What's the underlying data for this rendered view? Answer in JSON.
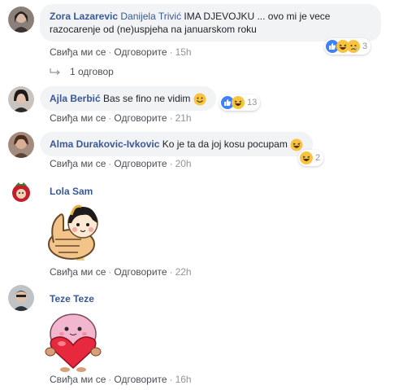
{
  "comments": [
    {
      "author": "Zora Lazarevic",
      "mention": "Danijela Trivić",
      "text": " IMA DJEVOJKU ... ovo mi je vece razocarenje od (ne)uspjeha na januarskom roku",
      "line1": " IMA DJEVOJKU ... ovo mi je vece",
      "line2": "razocarenje od (ne)uspjeha na januarskom roku",
      "like": "Свиђа ми се",
      "reply": "Одговорите",
      "time": "15h",
      "reaction_count": "3",
      "reactions": [
        "like-icon",
        "haha-icon",
        "sad-icon"
      ],
      "replies": "1 одговор"
    },
    {
      "author": "Ajla Berbić",
      "text": "Bas se fino ne vidim",
      "like": "Свиђа ми се",
      "reply": "Одговорите",
      "time": "21h",
      "reaction_count": "13",
      "reactions": [
        "like-icon",
        "haha-icon"
      ]
    },
    {
      "author": "Alma Durakovic-Ivkovic",
      "text": "Ko je ta da joj kosu pocupam",
      "like": "Свиђа ми се",
      "reply": "Одговорите",
      "time": "20h",
      "reaction_count": "2",
      "reactions": [
        "haha-icon"
      ]
    },
    {
      "author": "Lola Sam",
      "like": "Свиђа ми се",
      "reply": "Одговорите",
      "time": "22h",
      "sticker": "thumbs-up-girl-sticker"
    },
    {
      "author": "Teze Teze",
      "like": "Свиђа ми се",
      "reply": "Одговорите",
      "time": "16h",
      "sticker": "pink-heart-character-sticker"
    }
  ],
  "colors": {
    "link": "#385898",
    "bubble": "#f2f3f5",
    "meta": "#90949c",
    "like_blue": "#4080ff",
    "haha_yellow": "#f7c340"
  }
}
